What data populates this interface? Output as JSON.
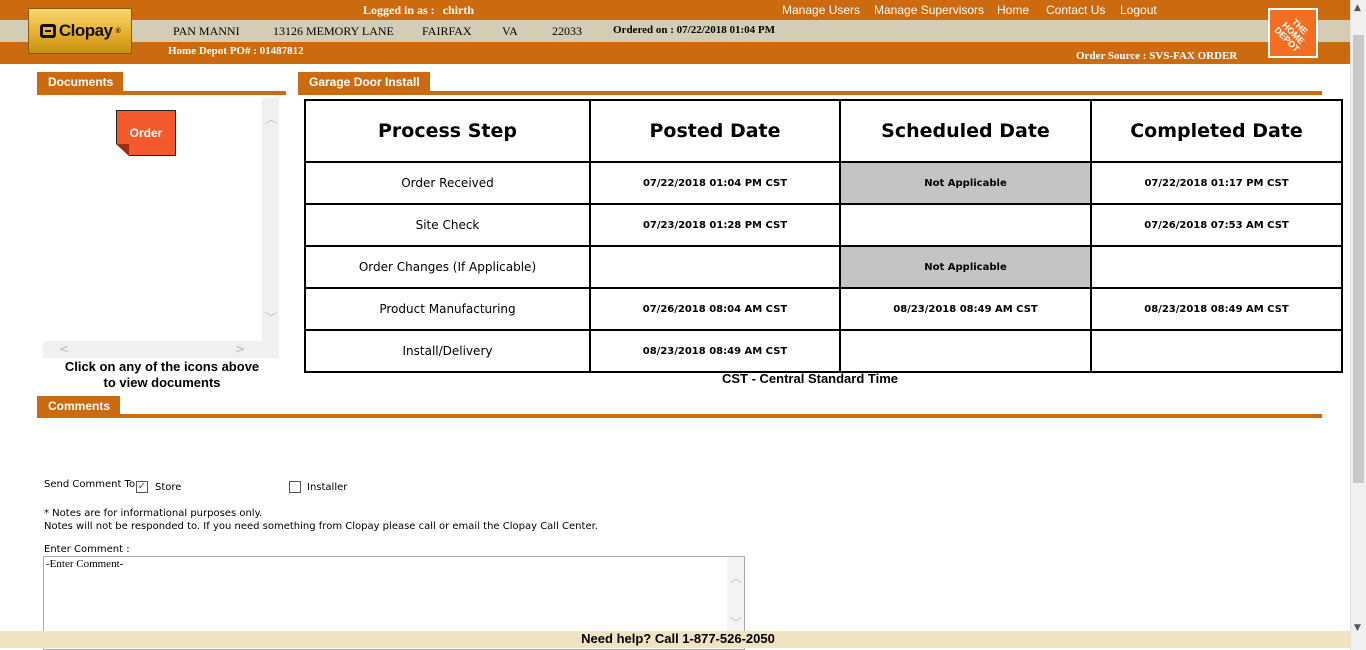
{
  "header": {
    "logged_in_label": "Logged in as :",
    "username": "chirth",
    "nav": [
      "Manage Users",
      "Manage Supervisors",
      "Home",
      "Contact Us",
      "Logout"
    ],
    "customer_name": "PAN MANNI",
    "street": "13126 MEMORY LANE",
    "city": "FAIRFAX",
    "state": "VA",
    "zip": "22033",
    "ordered_on": "Ordered on : 07/22/2018 01:04 PM",
    "po_number": "Home Depot PO# : 01487812",
    "order_source": "Order Source : SVS-FAX ORDER",
    "clopay_logo": "Clopay",
    "clopay_trademark": "®",
    "homedepot_logo": "THE HOME DEPOT"
  },
  "documents": {
    "tab_label": "Documents",
    "icons": [
      {
        "label": "Order",
        "color": "#f25a2e"
      }
    ],
    "help_text": "Click on any of the icons above to view documents"
  },
  "process": {
    "tab_label": "Garage Door Install",
    "headers": [
      "Process Step",
      "Posted Date",
      "Scheduled Date",
      "Completed Date"
    ],
    "rows": [
      {
        "step": "Order Received",
        "posted": "07/22/2018 01:04 PM CST",
        "scheduled": "Not Applicable",
        "completed": "07/22/2018 01:17 PM CST"
      },
      {
        "step": "Site Check",
        "posted": "07/23/2018 01:28 PM CST",
        "scheduled": "",
        "completed": "07/26/2018 07:53 AM CST"
      },
      {
        "step": "Order Changes (If Applicable)",
        "posted": "",
        "scheduled": "Not Applicable",
        "completed": ""
      },
      {
        "step": "Product Manufacturing",
        "posted": "07/26/2018 08:04 AM CST",
        "scheduled": "08/23/2018 08:49 AM CST",
        "completed": "08/23/2018 08:49 AM CST"
      },
      {
        "step": "Install/Delivery",
        "posted": "08/23/2018 08:49 AM CST",
        "scheduled": "",
        "completed": ""
      }
    ],
    "timezone_note": "CST - Central Standard Time"
  },
  "comments": {
    "tab_label": "Comments",
    "send_label": "Send Comment To :",
    "store_label": "Store",
    "store_checked": true,
    "installer_label": "Installer",
    "installer_checked": false,
    "note_line1": "* Notes are for informational purposes only.",
    "note_line2": "Notes will not be responded to. If you need something from Clopay please call or email the Clopay Call Center.",
    "enter_label": "Enter Comment :",
    "comment_value": "-Enter Comment-"
  },
  "footer": {
    "help_text": "Need help? Call 1-877-526-2050"
  },
  "colors": {
    "brand_orange": "#cc6a0f",
    "header_grey": "#d4ccb4",
    "footer_beige": "#efe3c2",
    "not_applicable_grey": "#c4c4c4"
  }
}
